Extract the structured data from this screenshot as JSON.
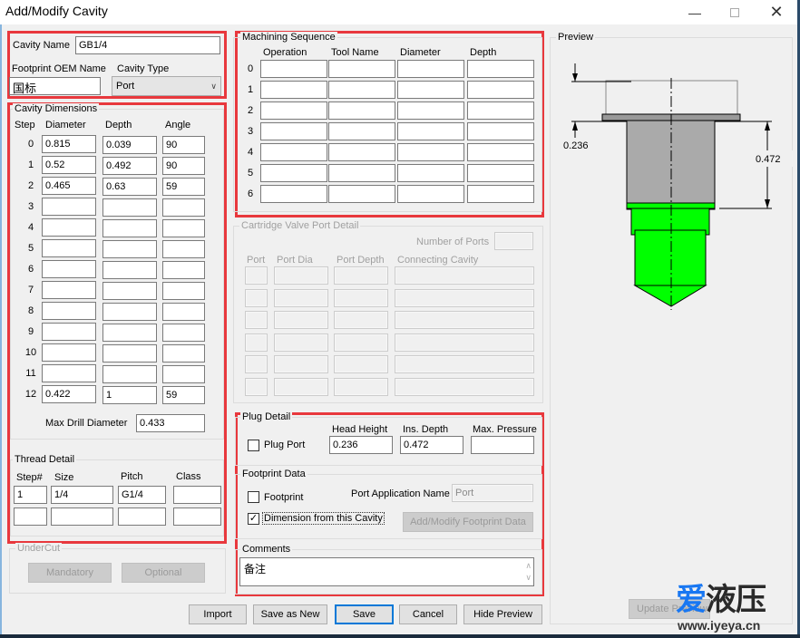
{
  "window": {
    "title": "Add/Modify Cavity",
    "minimize_icon": "minimize-icon",
    "maximize_icon": "maximize-icon",
    "close_icon": "close-icon"
  },
  "header": {
    "cavity_name_label": "Cavity Name",
    "cavity_name_value": "GB1/4",
    "footprint_oem_label": "Footprint OEM Name",
    "footprint_oem_value": "国标",
    "cavity_type_label": "Cavity Type",
    "cavity_type_value": "Port",
    "cavity_type_icon": "chevron-down-icon"
  },
  "cavity_dimensions": {
    "title": "Cavity Dimensions",
    "columns": [
      "Step",
      "Diameter",
      "Depth",
      "Angle"
    ],
    "rows": [
      {
        "step": "0",
        "diameter": "0.815",
        "depth": "0.039",
        "angle": "90"
      },
      {
        "step": "1",
        "diameter": "0.52",
        "depth": "0.492",
        "angle": "90"
      },
      {
        "step": "2",
        "diameter": "0.465",
        "depth": "0.63",
        "angle": "59"
      },
      {
        "step": "3",
        "diameter": "",
        "depth": "",
        "angle": ""
      },
      {
        "step": "4",
        "diameter": "",
        "depth": "",
        "angle": ""
      },
      {
        "step": "5",
        "diameter": "",
        "depth": "",
        "angle": ""
      },
      {
        "step": "6",
        "diameter": "",
        "depth": "",
        "angle": ""
      },
      {
        "step": "7",
        "diameter": "",
        "depth": "",
        "angle": ""
      },
      {
        "step": "8",
        "diameter": "",
        "depth": "",
        "angle": ""
      },
      {
        "step": "9",
        "diameter": "",
        "depth": "",
        "angle": ""
      },
      {
        "step": "10",
        "diameter": "",
        "depth": "",
        "angle": ""
      },
      {
        "step": "11",
        "diameter": "",
        "depth": "",
        "angle": ""
      },
      {
        "step": "12",
        "diameter": "0.422",
        "depth": "1",
        "angle": "59"
      }
    ],
    "max_drill_label": "Max Drill Diameter",
    "max_drill_value": "0.433"
  },
  "thread_detail": {
    "title": "Thread Detail",
    "columns": [
      "Step#",
      "Size",
      "Pitch",
      "Class"
    ],
    "rows": [
      {
        "step": "1",
        "size": "1/4",
        "pitch": "G1/4",
        "class": ""
      },
      {
        "step": "",
        "size": "",
        "pitch": "",
        "class": ""
      }
    ]
  },
  "undercut": {
    "title": "UnderCut",
    "mandatory_label": "Mandatory",
    "optional_label": "Optional"
  },
  "machining_sequence": {
    "title": "Machining Sequence",
    "columns": [
      "Operation",
      "Tool Name",
      "Diameter",
      "Depth"
    ],
    "rows": [
      {
        "n": "0",
        "operation": "",
        "tool": "",
        "diameter": "",
        "depth": ""
      },
      {
        "n": "1",
        "operation": "",
        "tool": "",
        "diameter": "",
        "depth": ""
      },
      {
        "n": "2",
        "operation": "",
        "tool": "",
        "diameter": "",
        "depth": ""
      },
      {
        "n": "3",
        "operation": "",
        "tool": "",
        "diameter": "",
        "depth": ""
      },
      {
        "n": "4",
        "operation": "",
        "tool": "",
        "diameter": "",
        "depth": ""
      },
      {
        "n": "5",
        "operation": "",
        "tool": "",
        "diameter": "",
        "depth": ""
      },
      {
        "n": "6",
        "operation": "",
        "tool": "",
        "diameter": "",
        "depth": ""
      }
    ]
  },
  "cartridge_port_detail": {
    "title": "Cartridge Valve Port Detail",
    "number_of_ports_label": "Number of Ports",
    "number_of_ports_value": "",
    "columns": [
      "Port",
      "Port Dia",
      "Port Depth",
      "Connecting Cavity"
    ],
    "row_count": 6
  },
  "plug_detail": {
    "title": "Plug Detail",
    "plug_port_label": "Plug Port",
    "plug_port_checked": false,
    "head_height_label": "Head Height",
    "head_height_value": "0.236",
    "ins_depth_label": "Ins. Depth",
    "ins_depth_value": "0.472",
    "max_pressure_label": "Max. Pressure",
    "max_pressure_value": ""
  },
  "footprint_data": {
    "title": "Footprint Data",
    "footprint_label": "Footprint",
    "footprint_checked": false,
    "port_app_label": "Port Application Name",
    "port_app_value": "Port",
    "dimension_label": "Dimension from this Cavity",
    "dimension_checked": true,
    "add_modify_label": "Add/Modify Footprint Data"
  },
  "comments": {
    "title": "Comments",
    "value": "备注",
    "scroll_up_icon": "scroll-up-icon",
    "scroll_down_icon": "scroll-down-icon"
  },
  "buttons": {
    "import": "Import",
    "save_as_new": "Save as New",
    "save": "Save",
    "cancel": "Cancel",
    "hide_preview": "Hide Preview"
  },
  "preview": {
    "title": "Preview",
    "head_height_dim": "0.236",
    "ins_depth_dim": "0.472",
    "update_button": "Update Preview",
    "plug_color": "#aaaaaa",
    "cavity_color": "#00ff00"
  },
  "watermark": {
    "brand_blue": "爱",
    "brand_rest": "液压",
    "url": "www.iyeya.cn"
  }
}
